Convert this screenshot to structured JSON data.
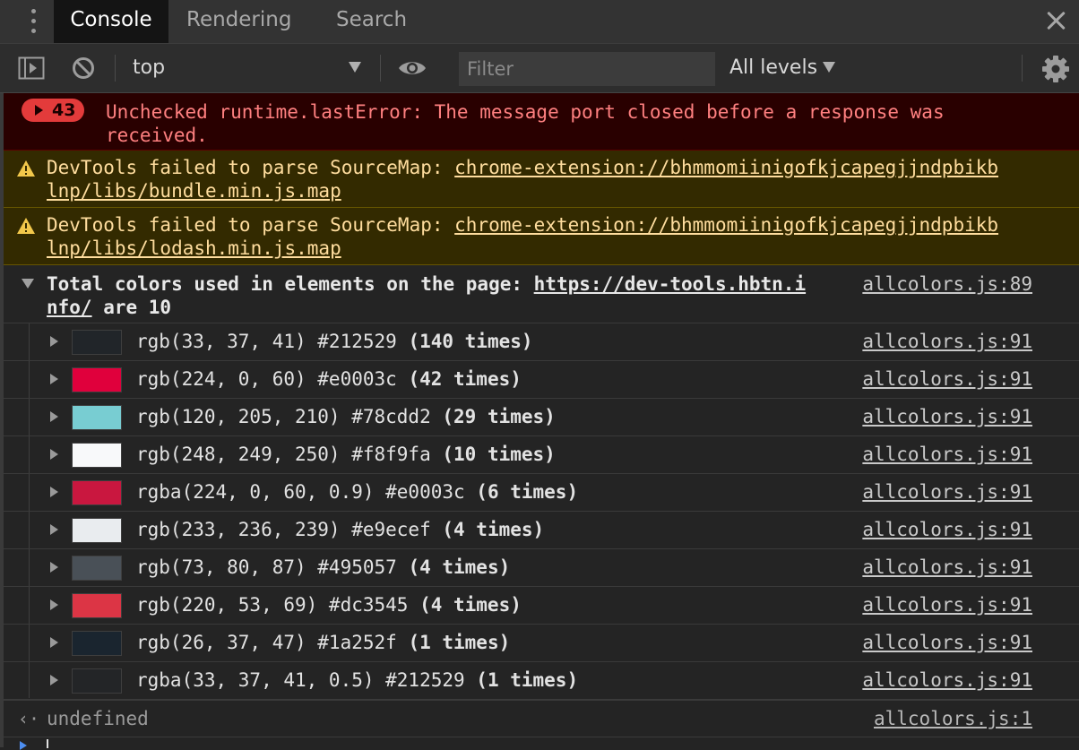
{
  "tabs": [
    {
      "label": "Console",
      "active": true
    },
    {
      "label": "Rendering",
      "active": false
    },
    {
      "label": "Search",
      "active": false
    }
  ],
  "toolbar": {
    "context": "top",
    "filter_placeholder": "Filter",
    "filter_value": "",
    "levels": "All levels"
  },
  "messages": {
    "error": {
      "count": "43",
      "text": "Unchecked runtime.lastError: The message port closed before a response was\nreceived."
    },
    "warnings": [
      {
        "prefix": "DevTools failed to parse SourceMap: ",
        "link": "chrome-extension://bhmmomiinigofkjcapegjjndpbikb\nlnp/libs/bundle.min.js.map"
      },
      {
        "prefix": "DevTools failed to parse SourceMap: ",
        "link": "chrome-extension://bhmmomiinigofkjcapegjjndpbikb\nlnp/libs/lodash.min.js.map"
      }
    ]
  },
  "group": {
    "prefix": "Total colors used in elements on the page: ",
    "link": "https://dev-tools.hbtn.i\nnfo/",
    "suffix": " are 10",
    "source": "allcolors.js:89"
  },
  "colors": [
    {
      "swatch": "#212529",
      "label": "rgb(33, 37, 41) #212529 ",
      "count": "(140 times)",
      "source": "allcolors.js:91"
    },
    {
      "swatch": "#e0003c",
      "label": "rgb(224, 0, 60) #e0003c ",
      "count": "(42 times)",
      "source": "allcolors.js:91"
    },
    {
      "swatch": "#78cdd2",
      "label": "rgb(120, 205, 210) #78cdd2 ",
      "count": "(29 times)",
      "source": "allcolors.js:91"
    },
    {
      "swatch": "#f8f9fa",
      "label": "rgb(248, 249, 250) #f8f9fa ",
      "count": "(10 times)",
      "source": "allcolors.js:91"
    },
    {
      "swatch": "#c9173f",
      "label": "rgba(224, 0, 60, 0.9) #e0003c ",
      "count": "(6 times)",
      "source": "allcolors.js:91"
    },
    {
      "swatch": "#e9ecef",
      "label": "rgb(233, 236, 239) #e9ecef ",
      "count": "(4 times)",
      "source": "allcolors.js:91"
    },
    {
      "swatch": "#495057",
      "label": "rgb(73, 80, 87) #495057 ",
      "count": "(4 times)",
      "source": "allcolors.js:91"
    },
    {
      "swatch": "#dc3545",
      "label": "rgb(220, 53, 69) #dc3545 ",
      "count": "(4 times)",
      "source": "allcolors.js:91"
    },
    {
      "swatch": "#1a252f",
      "label": "rgb(26, 37, 47) #1a252f ",
      "count": "(1 times)",
      "source": "allcolors.js:91"
    },
    {
      "swatch": "#232527",
      "label": "rgba(33, 37, 41, 0.5) #212529 ",
      "count": "(1 times)",
      "source": "allcolors.js:91"
    }
  ],
  "result": {
    "text": "undefined",
    "source": "allcolors.js:1"
  }
}
